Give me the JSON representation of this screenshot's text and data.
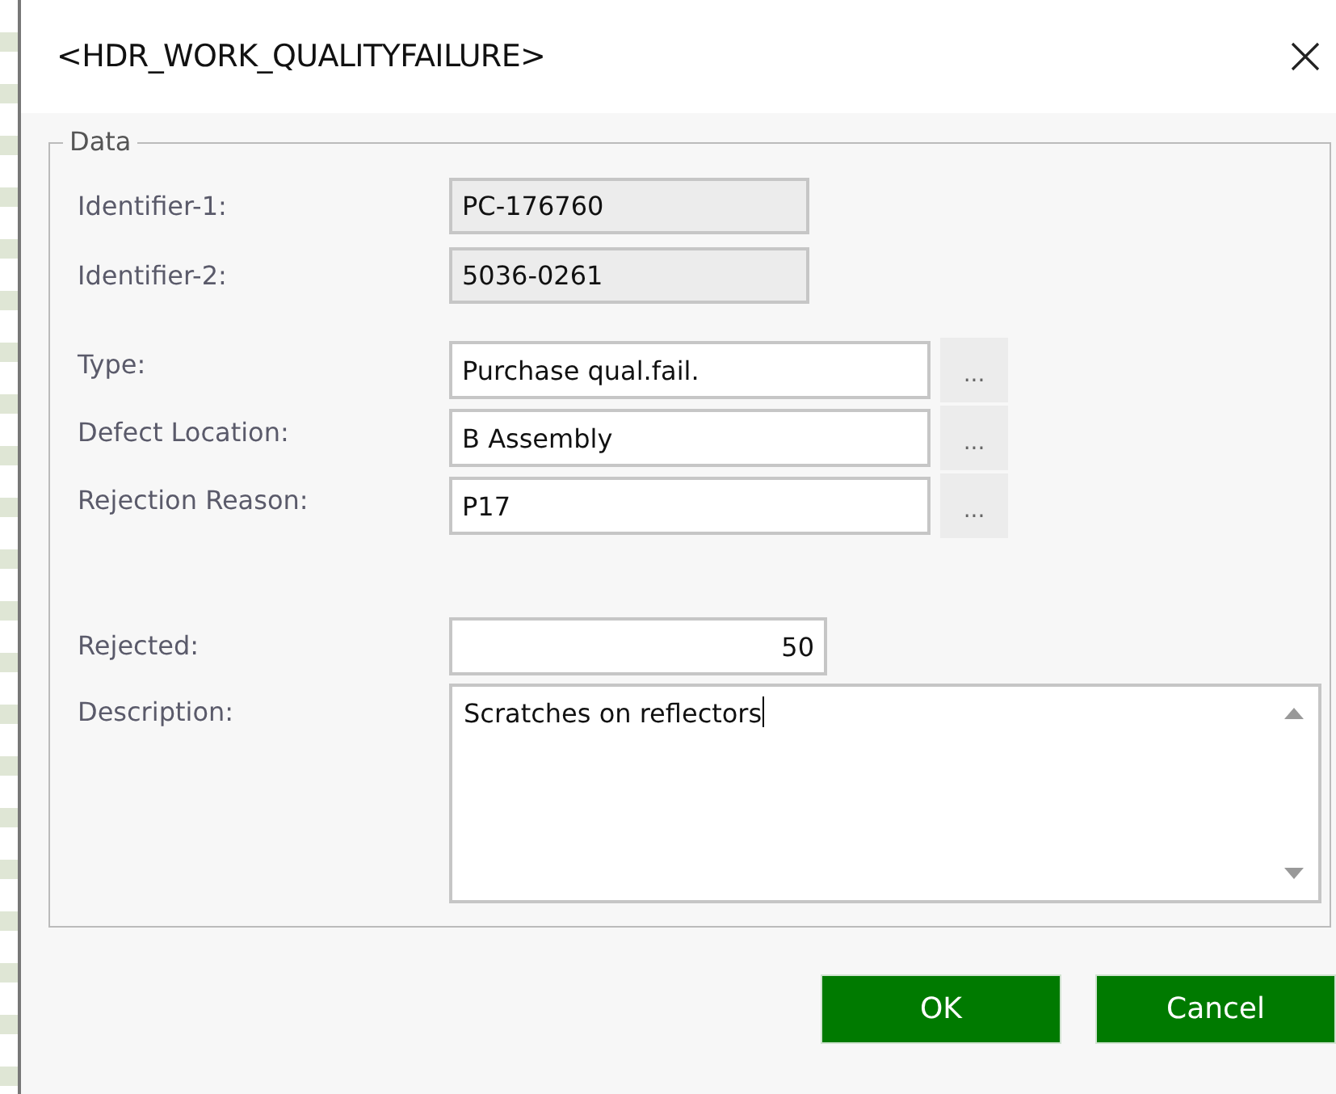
{
  "window": {
    "title": "<HDR_WORK_QUALITYFAILURE>"
  },
  "group": {
    "legend": "Data",
    "fields": [
      {
        "kind": "readonly",
        "label": "Identifier-1:",
        "value": "PC-176760"
      },
      {
        "kind": "readonly",
        "label": "Identifier-2:",
        "value": "5036-0261"
      },
      {
        "kind": "lookup",
        "label": "Type:",
        "value": "Purchase qual.fail.",
        "browse": "..."
      },
      {
        "kind": "lookup",
        "label": "Defect Location:",
        "value": "B Assembly",
        "browse": "..."
      },
      {
        "kind": "lookup",
        "label": "Rejection Reason:",
        "value": "P17",
        "browse": "..."
      },
      {
        "kind": "number",
        "label": "Rejected:",
        "value": "50"
      },
      {
        "kind": "memo",
        "label": "Description:",
        "value": "Scratches on reflectors",
        "focused": true
      }
    ]
  },
  "buttons": [
    "OK",
    "Cancel"
  ]
}
